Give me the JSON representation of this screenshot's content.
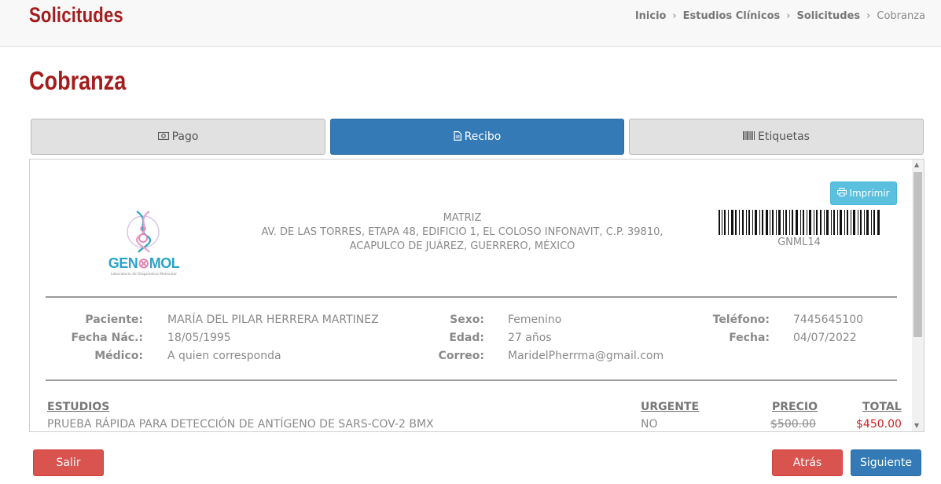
{
  "header": {
    "app_title": "Solicitudes",
    "breadcrumb": [
      "Inicio",
      "Estudios Clínicos",
      "Solicitudes"
    ],
    "breadcrumb_current": "Cobranza"
  },
  "page_title": "Cobranza",
  "tabs": [
    {
      "label": "Pago",
      "icon": "money-icon"
    },
    {
      "label": "Recibo",
      "icon": "file-text-icon"
    },
    {
      "label": "Etiquetas",
      "icon": "barcode-icon"
    }
  ],
  "receipt": {
    "print_label": "Imprimir",
    "logo": {
      "text_gen": "GEN",
      "text_mol": "MOL",
      "subtitle": "Laboratorio de Diagnóstico Molecular"
    },
    "address_lines": [
      "MATRIZ",
      "AV. DE LAS TORRES, ETAPA 48, EDIFICIO 1, EL COLOSO INFONAVIT, C.P. 39810,",
      "ACAPULCO DE JUÁREZ, GUERRERO, MÉXICO"
    ],
    "barcode_text": "GNML14",
    "patient": {
      "paciente_label": "Paciente:",
      "paciente": "MARÍA DEL PILAR HERRERA MARTINEZ",
      "fecha_nac_label": "Fecha Nác.:",
      "fecha_nac": "18/05/1995",
      "medico_label": "Médico:",
      "medico": "A quien corresponda",
      "sexo_label": "Sexo:",
      "sexo": "Femenino",
      "edad_label": "Edad:",
      "edad": "27 años",
      "correo_label": "Correo:",
      "correo": "MaridelPherrma@gmail.com",
      "telefono_label": "Teléfono:",
      "telefono": "7445645100",
      "fecha_label": "Fecha:",
      "fecha": "04/07/2022"
    },
    "table": {
      "headers": [
        "ESTUDIOS",
        "URGENTE",
        "PRECIO",
        "TOTAL"
      ],
      "rows": [
        {
          "estudio": "PRUEBA RÁPIDA PARA DETECCIÓN DE ANTÍGENO DE SARS-COV-2 BMX",
          "urgente": "NO",
          "precio": "$500.00",
          "total": "$450.00"
        }
      ]
    }
  },
  "footer": {
    "salir": "Salir",
    "atras": "Atrás",
    "siguiente": "Siguiente"
  },
  "colors": {
    "brand_red": "#a51c1c",
    "primary": "#337ab7",
    "danger": "#d9534f",
    "info": "#5bc0de"
  }
}
